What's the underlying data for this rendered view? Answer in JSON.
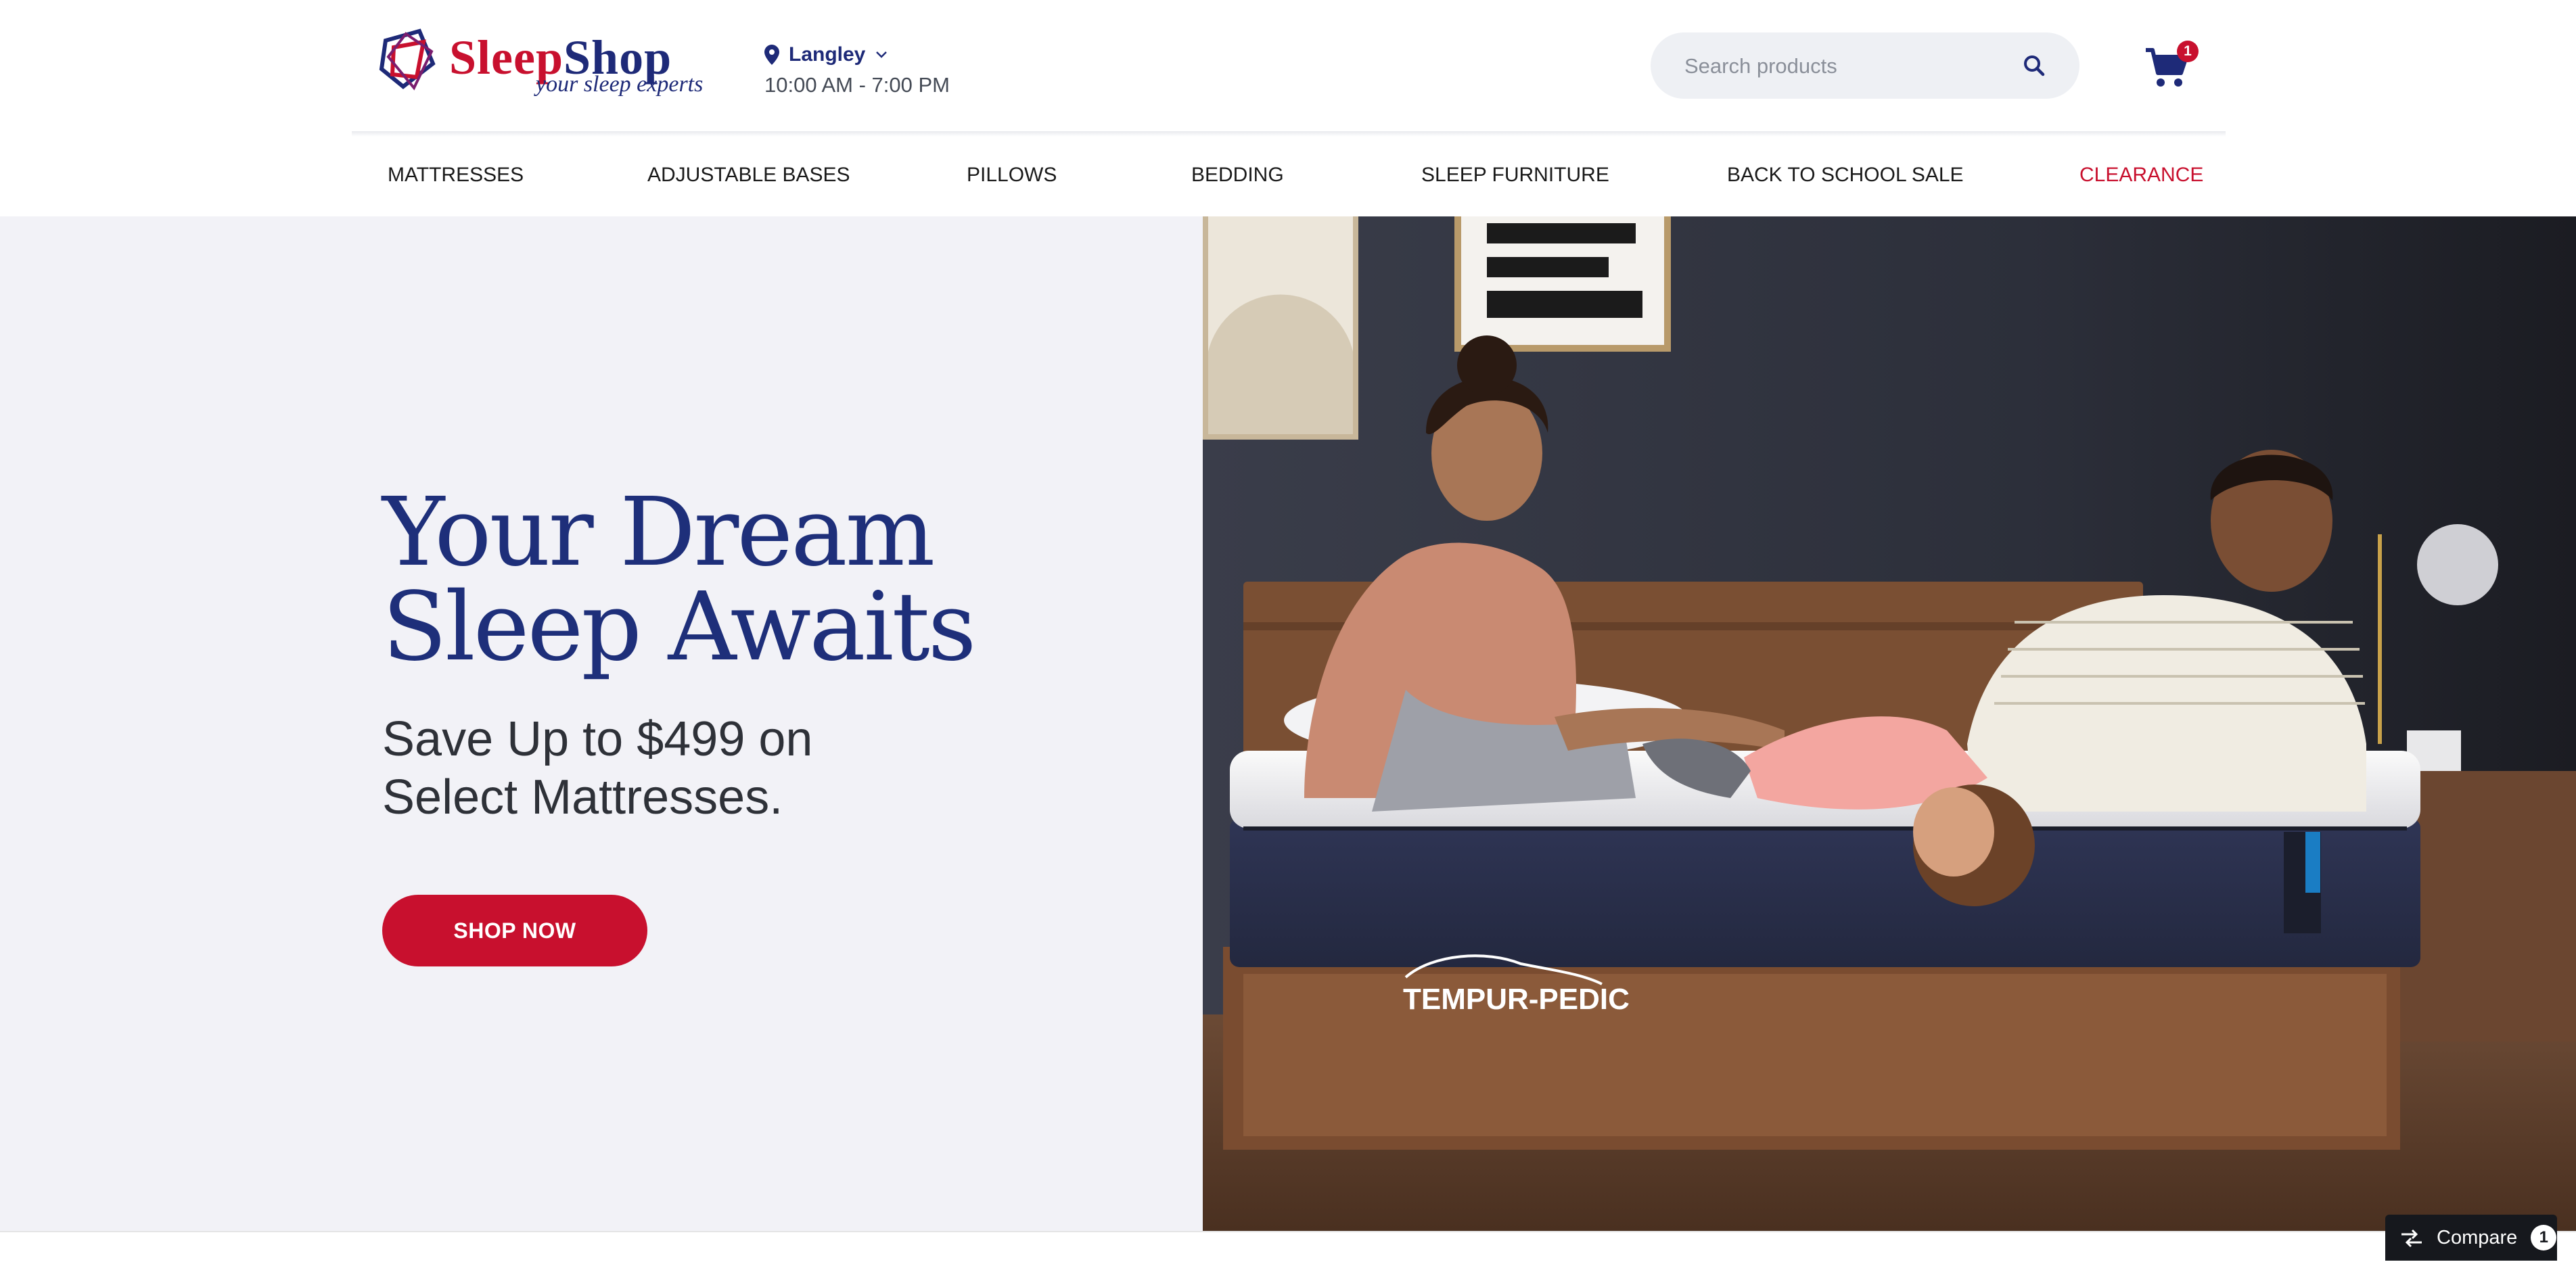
{
  "header": {
    "logo": {
      "word1": "Sleep",
      "word2": "Shop",
      "tagline": "your sleep experts"
    },
    "location": {
      "name": "Langley",
      "hours": "10:00 AM - 7:00 PM"
    },
    "search": {
      "placeholder": "Search products",
      "value": ""
    },
    "cart": {
      "count": "1"
    }
  },
  "nav": {
    "items": [
      "MATTRESSES",
      "ADJUSTABLE BASES",
      "PILLOWS",
      "BEDDING",
      "SLEEP FURNITURE",
      "BACK TO SCHOOL SALE",
      "CLEARANCE"
    ]
  },
  "hero": {
    "title_line1": "Your Dream",
    "title_line2": "Sleep Awaits",
    "sub_line1": "Save Up to $499 on",
    "sub_line2": "Select Mattresses.",
    "button": "SHOP NOW",
    "image_brand": "TEMPUR-PEDIC"
  },
  "compare": {
    "label": "Compare",
    "count": "1"
  },
  "colors": {
    "brand_red": "#c8102e",
    "brand_navy": "#1e2a78",
    "hero_bg": "#f2f2f7"
  }
}
